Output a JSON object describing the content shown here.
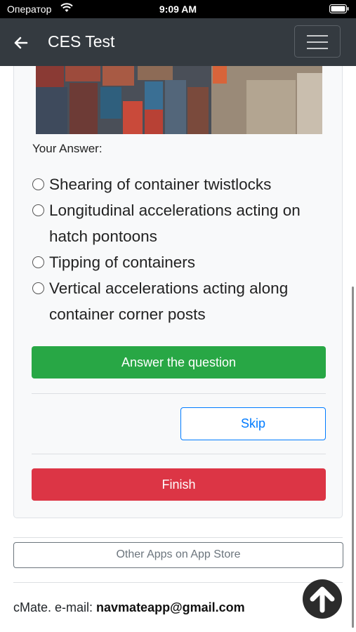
{
  "status_bar": {
    "carrier": "Оператор",
    "time": "9:09 AM"
  },
  "navbar": {
    "title": "CES Test",
    "back_icon": "back-arrow-icon",
    "menu_icon": "hamburger-menu-icon"
  },
  "question": {
    "image_alt": "container-ship-deck-photo",
    "your_answer_label": "Your Answer:",
    "options": [
      {
        "line1": "Shearing of container twistlocks",
        "line2": ""
      },
      {
        "line1": "Longitudinal accelerations acting on",
        "line2": "hatch pontoons"
      },
      {
        "line1": "Tipping of containers",
        "line2": ""
      },
      {
        "line1": "Vertical accelerations acting along",
        "line2": "container corner posts"
      }
    ]
  },
  "buttons": {
    "answer": "Answer the question",
    "skip": "Skip",
    "finish": "Finish"
  },
  "other_apps": "Other Apps on App Store",
  "footer": {
    "prefix": "cMate. e-mail: ",
    "email": "navmateapp@gmail.com"
  },
  "colors": {
    "navbar": "#343a40",
    "answer": "#28a745",
    "skip": "#007bff",
    "finish": "#dc3545"
  }
}
